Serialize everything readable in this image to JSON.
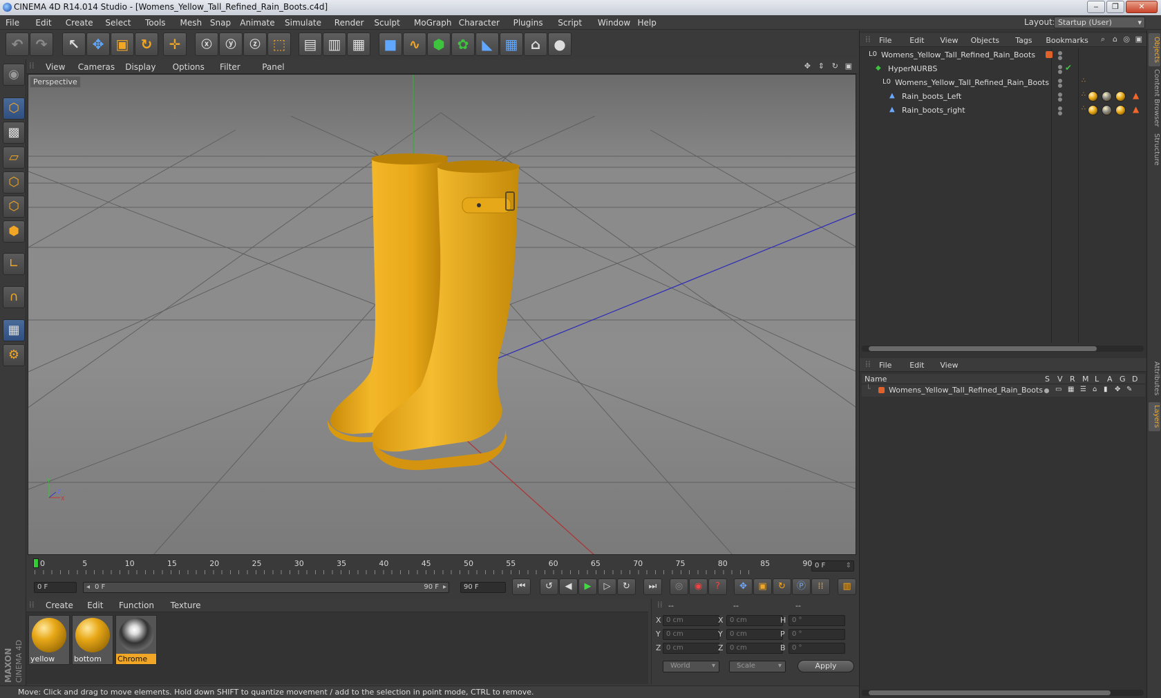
{
  "window": {
    "title": "CINEMA 4D R14.014 Studio - [Womens_Yellow_Tall_Refined_Rain_Boots.c4d]"
  },
  "menu": [
    "File",
    "Edit",
    "Create",
    "Select",
    "Tools",
    "Mesh",
    "Snap",
    "Animate",
    "Simulate",
    "Render",
    "Sculpt",
    "MoGraph",
    "Character",
    "Plugins",
    "Script",
    "Window",
    "Help"
  ],
  "layout": {
    "label": "Layout:",
    "value": "Startup (User)"
  },
  "viewport": {
    "menu": [
      "View",
      "Cameras",
      "Display",
      "Options",
      "Filter",
      "Panel"
    ],
    "label": "Perspective"
  },
  "timeline": {
    "ticks": [
      "0",
      "5",
      "10",
      "15",
      "20",
      "25",
      "30",
      "35",
      "40",
      "45",
      "50",
      "55",
      "60",
      "65",
      "70",
      "75",
      "80",
      "85",
      "90"
    ],
    "current_frame": "0 F",
    "start_field": "0 F",
    "range_start": "0 F",
    "range_end": "90 F",
    "end_field": "90 F"
  },
  "materials": {
    "menu": [
      "Create",
      "Edit",
      "Function",
      "Texture"
    ],
    "items": [
      {
        "name": "yellow",
        "color": "#e8a817"
      },
      {
        "name": "bottom",
        "color": "#e8a817"
      },
      {
        "name": "Chrome",
        "color": "#bbbbbb"
      }
    ]
  },
  "coords": {
    "headers": [
      "--",
      "--",
      "--"
    ],
    "rows": [
      {
        "a": "X",
        "av": "0 cm",
        "b": "X",
        "bv": "0 cm",
        "c": "H",
        "cv": "0 °"
      },
      {
        "a": "Y",
        "av": "0 cm",
        "b": "Y",
        "bv": "0 cm",
        "c": "P",
        "cv": "0 °"
      },
      {
        "a": "Z",
        "av": "0 cm",
        "b": "Z",
        "bv": "0 cm",
        "c": "B",
        "cv": "0 °"
      }
    ],
    "world": "World",
    "scale": "Scale",
    "apply": "Apply"
  },
  "status": "Move: Click and drag to move elements. Hold down SHIFT to quantize movement / add to the selection in point mode, CTRL to remove.",
  "objects": {
    "menu": [
      "File",
      "Edit",
      "View",
      "Objects",
      "Tags",
      "Bookmarks"
    ],
    "tree": [
      {
        "name": "Womens_Yellow_Tall_Refined_Rain_Boots"
      },
      {
        "name": "HyperNURBS"
      },
      {
        "name": "Womens_Yellow_Tall_Refined_Rain_Boots"
      },
      {
        "name": "Rain_boots_Left"
      },
      {
        "name": "Rain_boots_right"
      }
    ]
  },
  "layers": {
    "menu": [
      "File",
      "Edit",
      "View"
    ],
    "columns": {
      "name": "Name",
      "flags": [
        "S",
        "V",
        "R",
        "M",
        "L",
        "A",
        "G",
        "D"
      ]
    },
    "row": "Womens_Yellow_Tall_Refined_Rain_Boots"
  },
  "side_tabs": [
    "Objects",
    "Content Browser",
    "Structure",
    "Attributes",
    "Layers"
  ],
  "brand": {
    "logo": "MAXON CINEMA 4D"
  },
  "colors": {
    "accent": "#f1a626",
    "boot": "#e8a817"
  }
}
